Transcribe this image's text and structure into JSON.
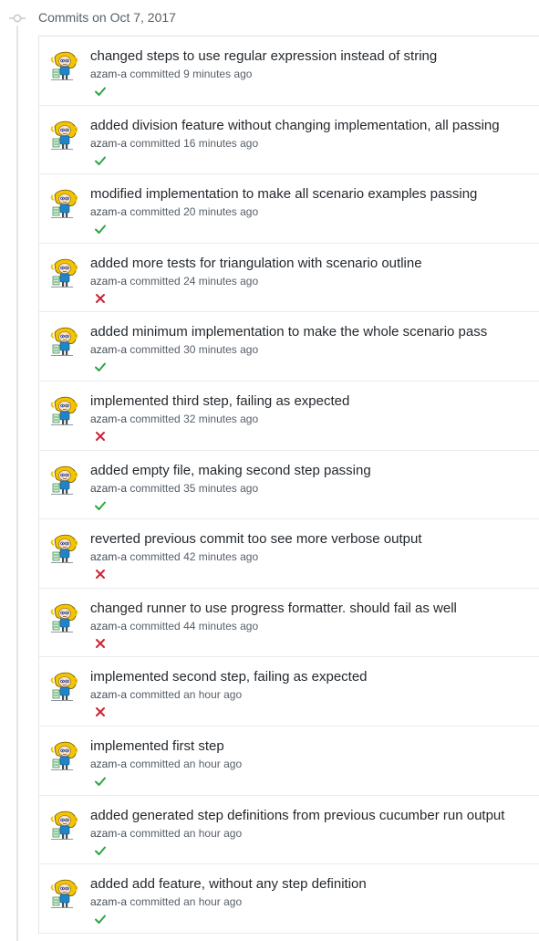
{
  "group": {
    "title": "Commits on Oct 7, 2017"
  },
  "commits": [
    {
      "message": "changed steps to use regular expression instead of string",
      "author": "azam-a",
      "committed": "committed",
      "time": "9 minutes ago",
      "status": "success"
    },
    {
      "message": "added division feature without changing implementation, all passing",
      "author": "azam-a",
      "committed": "committed",
      "time": "16 minutes ago",
      "status": "success"
    },
    {
      "message": "modified implementation to make all scenario examples passing",
      "author": "azam-a",
      "committed": "committed",
      "time": "20 minutes ago",
      "status": "success"
    },
    {
      "message": "added more tests for triangulation with scenario outline",
      "author": "azam-a",
      "committed": "committed",
      "time": "24 minutes ago",
      "status": "failure"
    },
    {
      "message": "added minimum implementation to make the whole scenario pass",
      "author": "azam-a",
      "committed": "committed",
      "time": "30 minutes ago",
      "status": "success"
    },
    {
      "message": "implemented third step, failing as expected",
      "author": "azam-a",
      "committed": "committed",
      "time": "32 minutes ago",
      "status": "failure"
    },
    {
      "message": "added empty file, making second step passing",
      "author": "azam-a",
      "committed": "committed",
      "time": "35 minutes ago",
      "status": "success"
    },
    {
      "message": "reverted previous commit too see more verbose output",
      "author": "azam-a",
      "committed": "committed",
      "time": "42 minutes ago",
      "status": "failure"
    },
    {
      "message": "changed runner to use progress formatter. should fail as well",
      "author": "azam-a",
      "committed": "committed",
      "time": "44 minutes ago",
      "status": "failure"
    },
    {
      "message": "implemented second step, failing as expected",
      "author": "azam-a",
      "committed": "committed",
      "time": "an hour ago",
      "status": "failure"
    },
    {
      "message": "implemented first step",
      "author": "azam-a",
      "committed": "committed",
      "time": "an hour ago",
      "status": "success"
    },
    {
      "message": "added generated step definitions from previous cucumber run output",
      "author": "azam-a",
      "committed": "committed",
      "time": "an hour ago",
      "status": "success"
    },
    {
      "message": "added add feature, without any step definition",
      "author": "azam-a",
      "committed": "committed",
      "time": "an hour ago",
      "status": "success"
    }
  ],
  "colors": {
    "success": "#28a745",
    "failure": "#cb2431",
    "timeline": "#e1e4e8",
    "muted_text": "#586069"
  },
  "icons": {
    "group": "git-commit-icon",
    "avatar": "avatar-image",
    "success": "check-icon",
    "failure": "x-icon"
  }
}
